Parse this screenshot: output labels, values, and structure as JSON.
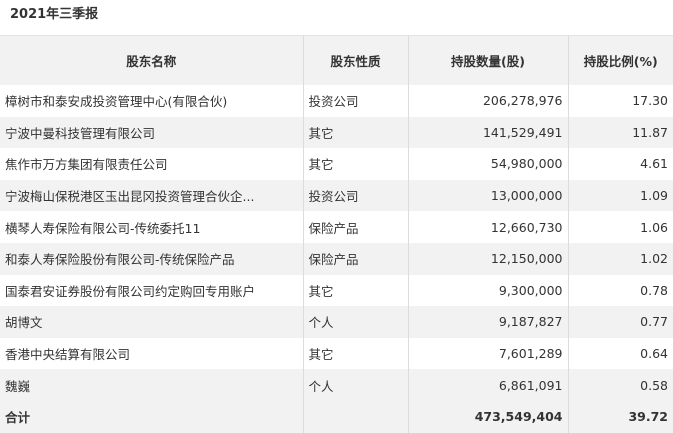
{
  "report": {
    "title": "2021年三季报"
  },
  "table": {
    "headers": [
      "股东名称",
      "股东性质",
      "持股数量(股)",
      "持股比例(%)"
    ],
    "rows": [
      {
        "name": "樟树市和泰安成投资管理中心(有限合伙)",
        "type": "投资公司",
        "shares": "206,278,976",
        "ratio": "17.30"
      },
      {
        "name": "宁波中曼科技管理有限公司",
        "type": "其它",
        "shares": "141,529,491",
        "ratio": "11.87"
      },
      {
        "name": "焦作市万方集团有限责任公司",
        "type": "其它",
        "shares": "54,980,000",
        "ratio": "4.61"
      },
      {
        "name": "宁波梅山保税港区玉出昆冈投资管理合伙企...",
        "type": "投资公司",
        "shares": "13,000,000",
        "ratio": "1.09"
      },
      {
        "name": "横琴人寿保险有限公司-传统委托11",
        "type": "保险产品",
        "shares": "12,660,730",
        "ratio": "1.06"
      },
      {
        "name": "和泰人寿保险股份有限公司-传统保险产品",
        "type": "保险产品",
        "shares": "12,150,000",
        "ratio": "1.02"
      },
      {
        "name": "国泰君安证券股份有限公司约定购回专用账户",
        "type": "其它",
        "shares": "9,300,000",
        "ratio": "0.78"
      },
      {
        "name": "胡博文",
        "type": "个人",
        "shares": "9,187,827",
        "ratio": "0.77"
      },
      {
        "name": "香港中央结算有限公司",
        "type": "其它",
        "shares": "7,601,289",
        "ratio": "0.64"
      },
      {
        "name": "魏巍",
        "type": "个人",
        "shares": "6,861,091",
        "ratio": "0.58"
      }
    ],
    "total": {
      "label": "合计",
      "type": "",
      "shares": "473,549,404",
      "ratio": "39.72"
    }
  }
}
